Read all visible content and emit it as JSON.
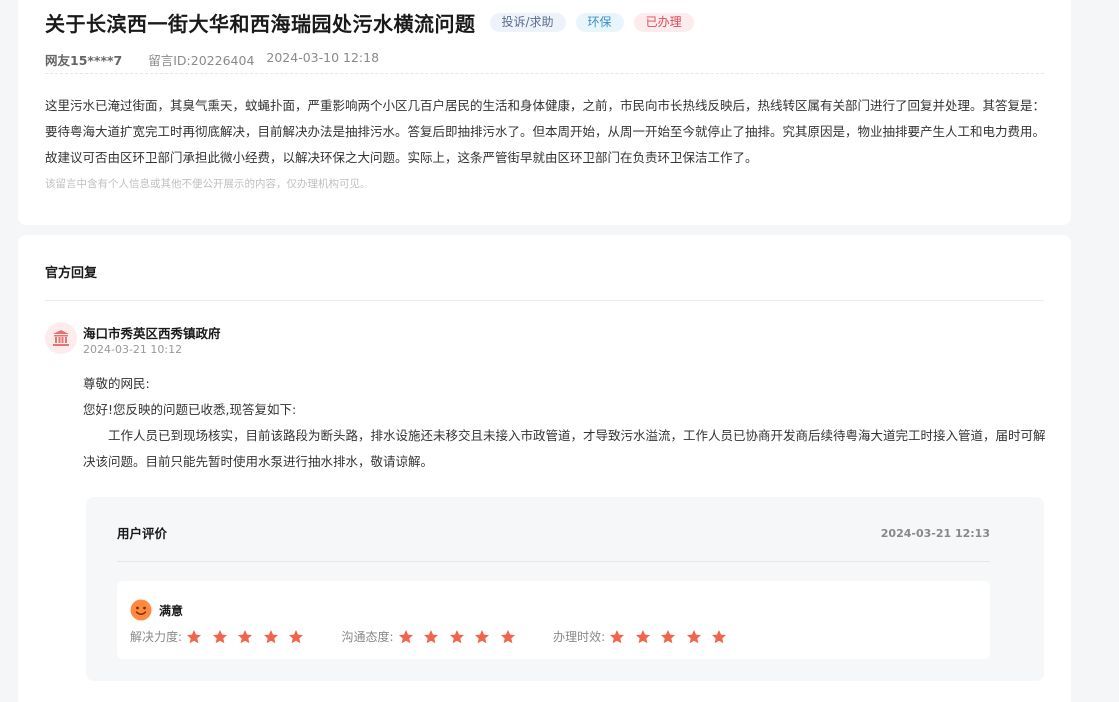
{
  "post": {
    "title": "关于长滨西一街大华和西海瑞园处污水横流问题",
    "tags": [
      "投诉/求助",
      "环保",
      "已办理"
    ],
    "user": "网友15****7",
    "message_id": "留言ID:20226404",
    "datetime": "2024-03-10 12:18",
    "content": "这里污水已淹过街面，其臭气熏天，蚊蝇扑面，严重影响两个小区几百户居民的生活和身体健康，之前，市民向市长热线反映后，热线转区属有关部门进行了回复并处理。其答复是：要待粤海大道扩宽完工时再彻底解决，目前解决办法是抽排污水。答复后即抽排污水了。但本周开始，从周一开始至今就停止了抽排。究其原因是，物业抽排要产生人工和电力费用。故建议可否由区环卫部门承担此微小经费，以解决环保之大问题。实际上，这条严管街早就由区环卫部门在负责环卫保洁工作了。",
    "notice": "该留言中含有个人信息或其他不便公开展示的内容，仅办理机构可见。"
  },
  "reply": {
    "section_title": "官方回复",
    "org_icon": "government-building-icon",
    "org_name": "海口市秀英区西秀镇政府",
    "org_time": "2024-03-21 10:12",
    "greeting": "尊敬的网民:",
    "intro": "您好!您反映的问题已收悉,现答复如下:",
    "body": "工作人员已到现场核实，目前该路段为断头路，排水设施还未移交且未接入市政管道，才导致污水溢流，工作人员已协商开发商后续待粤海大道完工时接入管道，届时可解决该问题。目前只能先暂时使用水泵进行抽水排水，敬请谅解。"
  },
  "evaluation": {
    "title": "用户评价",
    "time": "2024-03-21 12:13",
    "mood_icon": "smiley-face-icon",
    "mood": "满意",
    "ratings": [
      {
        "label": "解决力度:",
        "stars": 5
      },
      {
        "label": "沟通态度:",
        "stars": 5
      },
      {
        "label": "办理时效:",
        "stars": 5
      }
    ]
  },
  "colors": {
    "star": "#f0654c",
    "tag_done": "#e04b5a",
    "org_icon": "#e57373",
    "mood": "#ff8a3d"
  }
}
